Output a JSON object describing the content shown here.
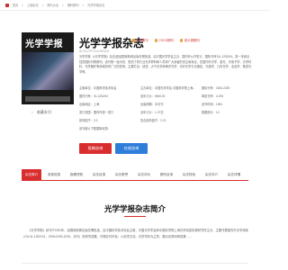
{
  "breadcrumb": [
    "首页",
    "上搜杂志",
    "期刊大全",
    "理科期刊",
    "光学学报杂志"
  ],
  "magazine": {
    "title": "光学学报杂志",
    "en_title": "ACTA OPTICA SINICA",
    "badges": [
      "北大期刊",
      "CSCD期刊",
      "统计源期刊"
    ],
    "cover_title": "光学学报",
    "description": "光学学报（《光学学报》杂志)是经国家新闻出版总署批准，由中国光学学会主办，国内外公开发行，国际刊号为1-1252/04。是一本综合性的国际刊物期刊。该刊物一经问世，受到了同行业光学界科研人员和广大读者的关注和肯定，在国内外光学、激光、光电子学、光学材料、光学器件等领域具有广泛的影响。主要栏目：综述、大气光学和海洋光学、光纤光学与光通信、光谱学、几何光学、全息学、集成光学等。",
    "favorite_label": "收藏本刊"
  },
  "meta": [
    [
      "主管单位：中国科学技术协会",
      "主办单位：中国光学学会 中国科学院上海…",
      "国际刊号：0253-2239"
    ],
    [
      "国内刊号：31-1252/04",
      "全年订价：¥600.00",
      "邮发代号：4-293"
    ],
    [
      "出版地区：上海",
      "出版周期：半月刊",
      "创刊时间：1981"
    ],
    [
      "发行范围：国内外统一发行",
      "全年订价：1-37亮",
      "数据统计：14"
    ],
    [
      "影响因子：3.3",
      "复合影响因子：2.21",
      ""
    ],
    [
      "该刊被以下数据库收录：",
      "",
      ""
    ]
  ],
  "buttons": {
    "subscribe": "投稿咨询",
    "consult": "在线咨询"
  },
  "tabs": [
    "杂志简介",
    "收录信息",
    "投稿须知",
    "杂志目录",
    "杂志荣誉",
    "杂志评价",
    "期刊目录",
    "杂志特色",
    "杂志评介",
    "杂志详情"
  ],
  "active_tab": 0,
  "section": {
    "title": "光学学报杂志简介",
    "paragraph": "《光学学报》创刊于1981年，经国家新闻出版总署批准，由中国科学技术协会主管，中国光学学会和中国科学院上海光学精密机械研究所主办，主要刊载国内外光学领域（CN:31-1252/O4，ISSN:0253-2239，月刊）的研究成果。刊物办刊宗旨：以科学文化、光学学科为主导，展示优秀科研成果……"
  },
  "colors": {
    "accent": "#d92e2e",
    "consult": "#2e7dd9"
  }
}
